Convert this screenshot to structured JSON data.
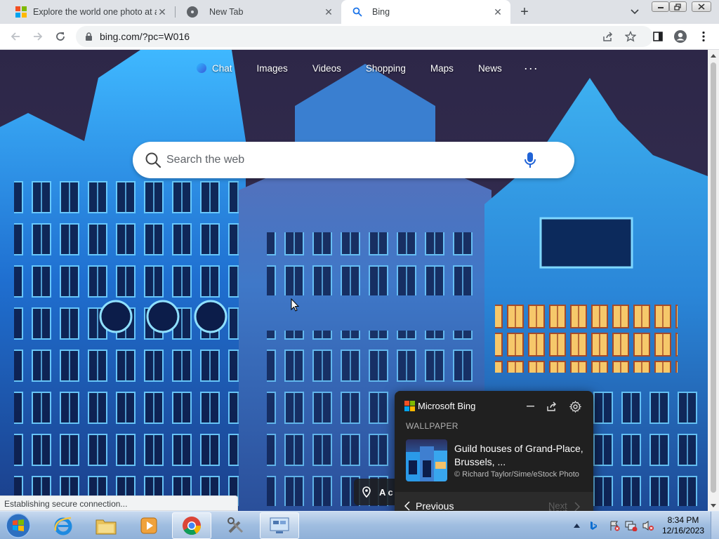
{
  "window": {
    "title": "Bing"
  },
  "tabs": [
    {
      "title": "Explore the world one photo at a",
      "favicon": "microsoft-logo-icon"
    },
    {
      "title": "New Tab",
      "favicon": "chrome-icon"
    },
    {
      "title": "Bing",
      "favicon": "bing-search-icon",
      "active": true
    }
  ],
  "toolbar": {
    "url": "bing.com/?pc=W016"
  },
  "bing": {
    "nav": [
      "Chat",
      "Images",
      "Videos",
      "Shopping",
      "Maps",
      "News"
    ],
    "more": "···",
    "search_placeholder": "Search the web",
    "location_chip": "A c"
  },
  "flyout": {
    "brand": "Microsoft Bing",
    "section": "WALLPAPER",
    "title": "Guild houses of Grand-Place, Brussels, ...",
    "credit": "© Richard Taylor/Sime/eStock Photo",
    "previous": "Previous",
    "next": "Next"
  },
  "status": "Establishing secure connection...",
  "taskbar": {
    "time": "8:34 PM",
    "date": "12/16/2023",
    "apps": [
      "internet-explorer-icon",
      "file-explorer-icon",
      "media-player-icon",
      "chrome-icon",
      "tools-icon",
      "control-panel-icon"
    ]
  },
  "colors": {
    "accent_blue": "#1a73e8",
    "ms_red": "#f25022",
    "ms_green": "#7fba00",
    "ms_blue": "#00a4ef",
    "ms_yellow": "#ffb900"
  }
}
